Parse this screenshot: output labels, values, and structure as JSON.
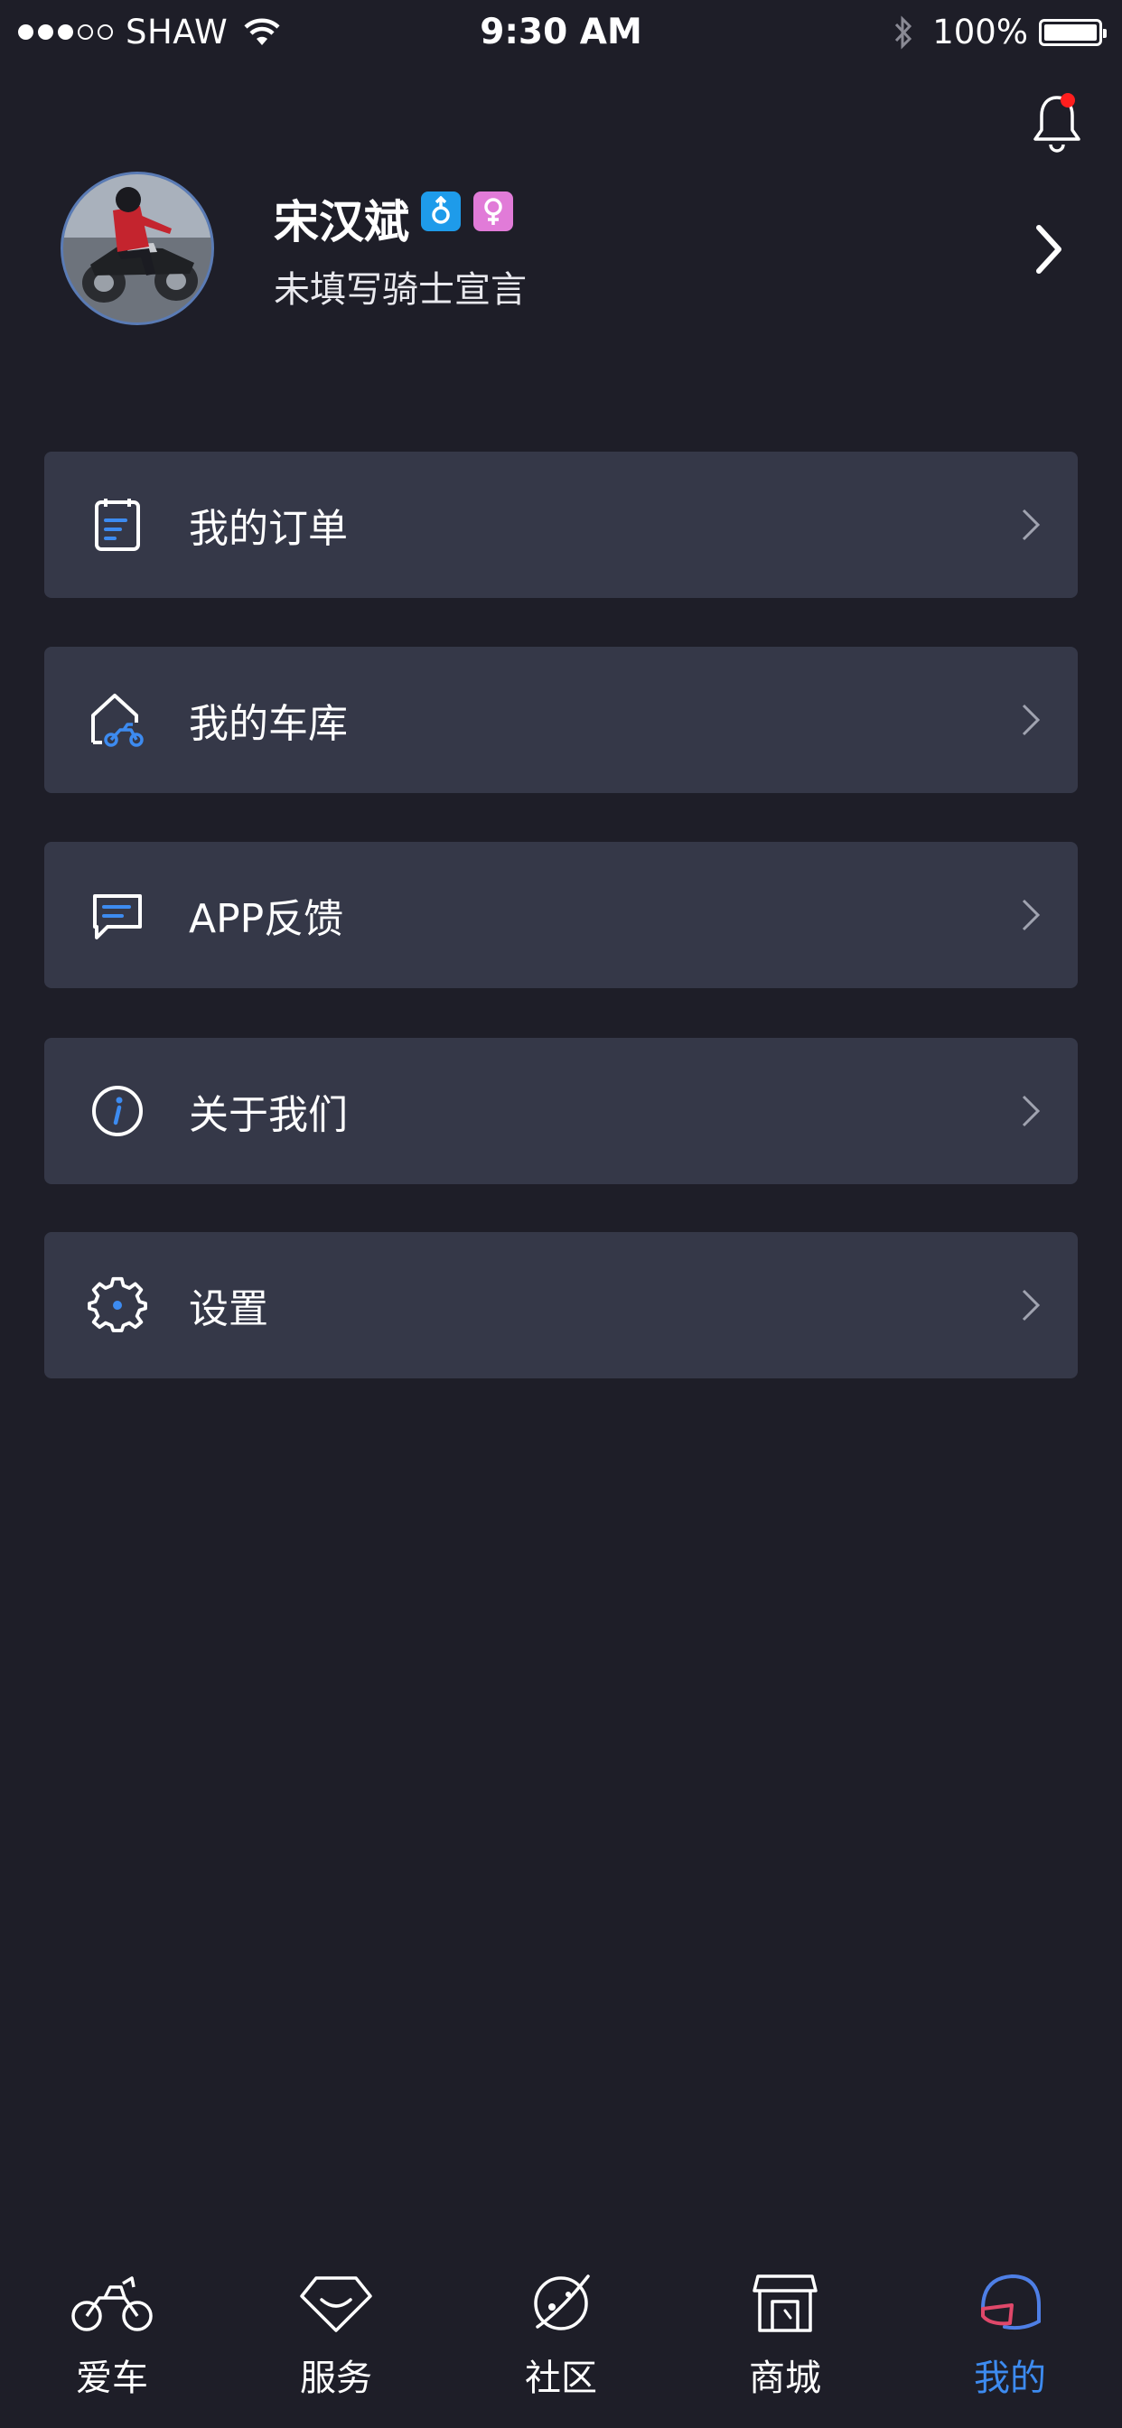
{
  "status_bar": {
    "carrier": "SHAW",
    "time": "9:30 AM",
    "battery": "100%"
  },
  "profile": {
    "name": "宋汉斌",
    "motto": "未填写骑士宣言"
  },
  "menu": [
    {
      "label": "我的订单",
      "icon": "order-icon"
    },
    {
      "label": "我的车库",
      "icon": "garage-icon"
    },
    {
      "label": "APP反馈",
      "icon": "feedback-icon"
    },
    {
      "label": "关于我们",
      "icon": "info-icon"
    },
    {
      "label": "设置",
      "icon": "settings-icon"
    }
  ],
  "tabs": [
    {
      "label": "爱车",
      "icon": "motorcycle-icon"
    },
    {
      "label": "服务",
      "icon": "diamond-icon"
    },
    {
      "label": "社区",
      "icon": "planet-icon"
    },
    {
      "label": "商城",
      "icon": "store-icon"
    },
    {
      "label": "我的",
      "icon": "helmet-icon",
      "active": true
    }
  ],
  "colors": {
    "background": "#1e1e28",
    "card": "#353848",
    "accent": "#3d8bf0",
    "notification_dot": "#ff1e1e"
  }
}
